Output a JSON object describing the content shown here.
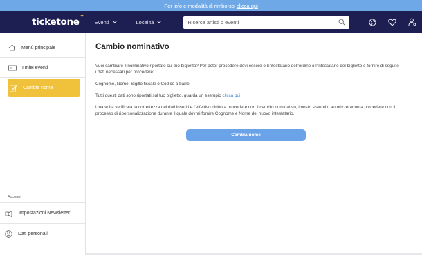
{
  "banner": {
    "text": "Per info e modalità di rimborso",
    "link": "clicca qui"
  },
  "navbar": {
    "logo": "ticketone",
    "events_label": "Eventi",
    "location_label": "Località",
    "search_placeholder": "Ricerca artisti o eventi"
  },
  "sidebar": {
    "items": [
      {
        "label": "Menù principale",
        "icon": "home-icon"
      },
      {
        "label": "I miei eventi",
        "icon": "ticket-icon"
      },
      {
        "label": "Cambia nome",
        "icon": "edit-icon"
      }
    ],
    "account_label": "Account",
    "account_items": [
      {
        "label": "Impostazioni Newsletter",
        "icon": "newsletter-icon"
      },
      {
        "label": "Dati personali",
        "icon": "user-icon"
      }
    ]
  },
  "main": {
    "title": "Cambio nominativo",
    "para1": "Vuoi cambiare il nominativo riportato sul tuo biglietto? Per poter procedere devi essere o l'intestatario dell'ordine o l'intestatario del biglietto e fornire di seguito i dati necessari per procedere:",
    "para2": "Cognome, Nome, Sigillo fiscale o Codice a barre",
    "para3_text": "Tutti questi dati sono riportati sul tuo biglietto, guarda un esempio",
    "para3_link": "clicca qui",
    "para4": "Una volta verificata la correttezza dei dati inseriti e l'effettivo diritto a procedere con il cambio nominativo, i nostri sistemi ti autorizzeranno a procedere con il processo di ripersonalizzazione durante il quale dovrai fornire Cognome e Nome del nuovo intestatario.",
    "button_label": "Cambia nome"
  },
  "colors": {
    "navbar": "#1d1e52",
    "banner": "#6fa8e6",
    "accent": "#f0c13b",
    "button": "#6aa3e8"
  }
}
